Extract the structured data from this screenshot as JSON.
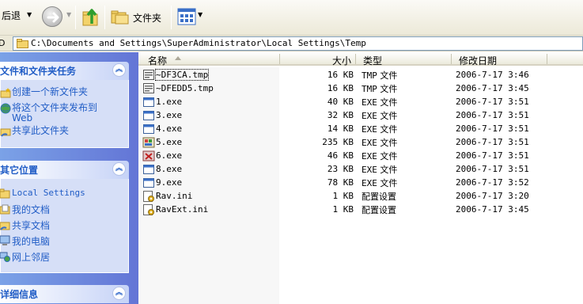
{
  "toolbar": {
    "back_label": "后退",
    "folders_label": "文件夹",
    "icons": [
      "back-arrow-icon",
      "forward-icon",
      "up-folder-icon",
      "folders-icon",
      "views-icon"
    ]
  },
  "address": {
    "label": "D",
    "path": "C:\\Documents and Settings\\SuperAdministrator\\Local Settings\\Temp"
  },
  "tasks_panel": {
    "title": "文件和文件夹任务",
    "items": [
      {
        "label": "创建一个新文件夹",
        "icon": "new-folder-icon"
      },
      {
        "label_line1": "将这个文件夹发布到",
        "label_line2": "Web",
        "icon": "publish-web-icon"
      },
      {
        "label": "共享此文件夹",
        "icon": "share-folder-icon"
      }
    ]
  },
  "places_panel": {
    "title": "其它位置",
    "items": [
      {
        "label": "Local Settings",
        "icon": "folder-icon"
      },
      {
        "label": "我的文档",
        "icon": "my-documents-icon"
      },
      {
        "label": "共享文档",
        "icon": "shared-documents-icon"
      },
      {
        "label": "我的电脑",
        "icon": "my-computer-icon"
      },
      {
        "label": "网上邻居",
        "icon": "network-places-icon"
      }
    ]
  },
  "details_panel": {
    "title": "详细信息"
  },
  "columns": {
    "name": "名称",
    "size": "大小",
    "type": "类型",
    "modified": "修改日期"
  },
  "files": [
    {
      "name": "~DF3CA.tmp",
      "size": "16 KB",
      "type_ext": "TMP",
      "type_word": "文件",
      "modified": "2006-7-17 3:46",
      "icon": "tmp-file-icon"
    },
    {
      "name": "~DFEDD5.tmp",
      "size": "16 KB",
      "type_ext": "TMP",
      "type_word": "文件",
      "modified": "2006-7-17 3:45",
      "icon": "tmp-file-icon"
    },
    {
      "name": "1.exe",
      "size": "40 KB",
      "type_ext": "EXE",
      "type_word": "文件",
      "modified": "2006-7-17 3:51",
      "icon": "exe-window-icon"
    },
    {
      "name": "3.exe",
      "size": "32 KB",
      "type_ext": "EXE",
      "type_word": "文件",
      "modified": "2006-7-17 3:51",
      "icon": "exe-window-icon"
    },
    {
      "name": "4.exe",
      "size": "14 KB",
      "type_ext": "EXE",
      "type_word": "文件",
      "modified": "2006-7-17 3:51",
      "icon": "exe-window-icon"
    },
    {
      "name": "5.exe",
      "size": "235 KB",
      "type_ext": "EXE",
      "type_word": "文件",
      "modified": "2006-7-17 3:51",
      "icon": "exe-colorful-icon"
    },
    {
      "name": "6.exe",
      "size": "46 KB",
      "type_ext": "EXE",
      "type_word": "文件",
      "modified": "2006-7-17 3:51",
      "icon": "exe-red-icon"
    },
    {
      "name": "8.exe",
      "size": "23 KB",
      "type_ext": "EXE",
      "type_word": "文件",
      "modified": "2006-7-17 3:51",
      "icon": "exe-window-icon"
    },
    {
      "name": "9.exe",
      "size": "78 KB",
      "type_ext": "EXE",
      "type_word": "文件",
      "modified": "2006-7-17 3:52",
      "icon": "exe-window-icon"
    },
    {
      "name": "Rav.ini",
      "size": "1 KB",
      "type_ext": "",
      "type_word": "配置设置",
      "modified": "2006-7-17 3:20",
      "icon": "ini-settings-icon"
    },
    {
      "name": "RavExt.ini",
      "size": "1 KB",
      "type_ext": "",
      "type_word": "配置设置",
      "modified": "2006-7-17 3:45",
      "icon": "ini-settings-icon"
    }
  ],
  "colors": {
    "task_link": "#215dc6",
    "pane_gradient_start": "#7ba2e7",
    "pane_gradient_end": "#6375d6",
    "panel_body": "#d6dff7"
  }
}
